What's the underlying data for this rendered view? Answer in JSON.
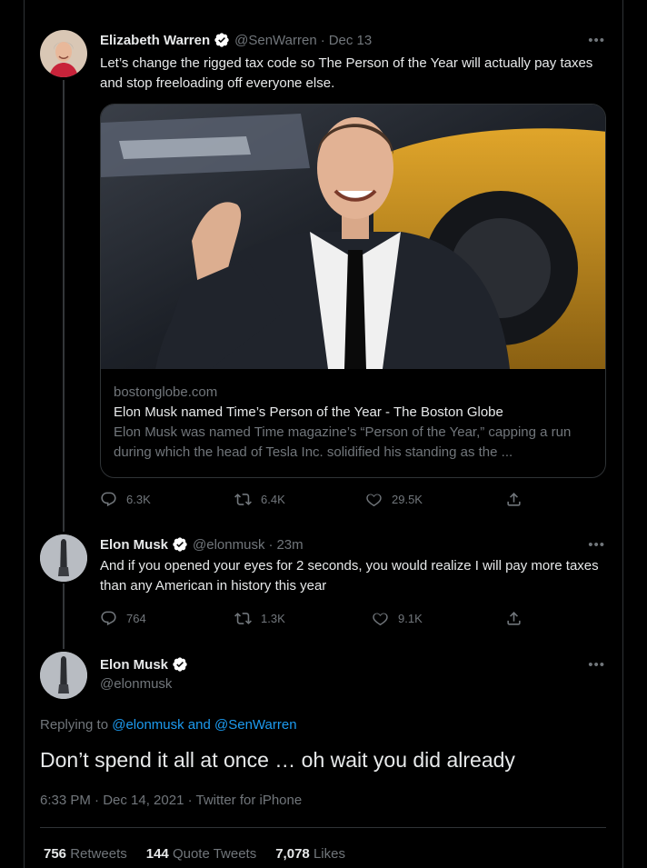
{
  "tweet1": {
    "name": "Elizabeth Warren",
    "handle": "@SenWarren",
    "sep": "·",
    "date": "Dec 13",
    "more": "•••",
    "text": "Let’s change the rigged tax code so The Person of the Year will actually pay taxes and stop freeloading off everyone else.",
    "card": {
      "domain": "bostonglobe.com",
      "title": "Elon Musk named Time’s Person of the Year - The Boston Globe",
      "description": "Elon Musk was named Time magazine’s “Person of the Year,” capping a run during which the head of Tesla Inc. solidified his standing as the ..."
    },
    "replies": "6.3K",
    "retweets": "6.4K",
    "likes": "29.5K"
  },
  "tweet2": {
    "name": "Elon Musk",
    "handle": "@elonmusk",
    "sep": "·",
    "date": "23m",
    "more": "•••",
    "text": "And if you opened your eyes for 2 seconds, you would realize I will pay more taxes than any American in history this year",
    "replies": "764",
    "retweets": "1.3K",
    "likes": "9.1K"
  },
  "main_tweet": {
    "name": "Elon Musk",
    "handle": "@elonmusk",
    "more": "•••",
    "replying_prefix": "Replying to",
    "replying_to": "@elonmusk and @SenWarren",
    "text": "Don’t spend it all at once … oh wait you did already",
    "time": "6:33 PM · Dec 14, 2021 · Twitter for iPhone",
    "stats": {
      "retweets_count": "756",
      "retweets_label": "Retweets",
      "quotes_count": "144",
      "quotes_label": "Quote Tweets",
      "likes_count": "7,078",
      "likes_label": "Likes"
    }
  },
  "colors": {
    "background": "#000000",
    "text": "#e7e9ea",
    "muted": "#71767b",
    "link": "#1d9bf0",
    "verified": "#ffffff"
  }
}
